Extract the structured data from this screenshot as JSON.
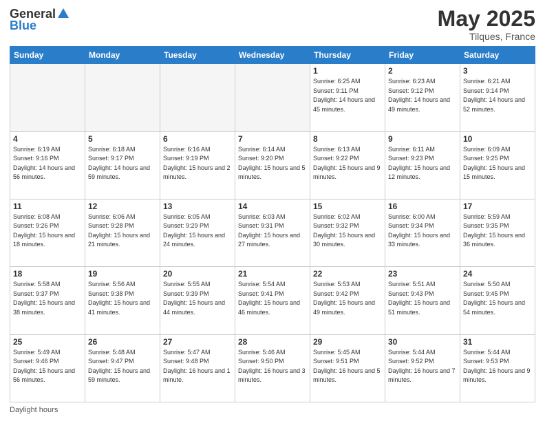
{
  "header": {
    "logo_general": "General",
    "logo_blue": "Blue",
    "title": "May 2025",
    "location": "Tilques, France"
  },
  "days_of_week": [
    "Sunday",
    "Monday",
    "Tuesday",
    "Wednesday",
    "Thursday",
    "Friday",
    "Saturday"
  ],
  "weeks": [
    [
      {
        "day": "",
        "info": ""
      },
      {
        "day": "",
        "info": ""
      },
      {
        "day": "",
        "info": ""
      },
      {
        "day": "",
        "info": ""
      },
      {
        "day": "1",
        "info": "Sunrise: 6:25 AM\nSunset: 9:11 PM\nDaylight: 14 hours\nand 45 minutes."
      },
      {
        "day": "2",
        "info": "Sunrise: 6:23 AM\nSunset: 9:12 PM\nDaylight: 14 hours\nand 49 minutes."
      },
      {
        "day": "3",
        "info": "Sunrise: 6:21 AM\nSunset: 9:14 PM\nDaylight: 14 hours\nand 52 minutes."
      }
    ],
    [
      {
        "day": "4",
        "info": "Sunrise: 6:19 AM\nSunset: 9:16 PM\nDaylight: 14 hours\nand 56 minutes."
      },
      {
        "day": "5",
        "info": "Sunrise: 6:18 AM\nSunset: 9:17 PM\nDaylight: 14 hours\nand 59 minutes."
      },
      {
        "day": "6",
        "info": "Sunrise: 6:16 AM\nSunset: 9:19 PM\nDaylight: 15 hours\nand 2 minutes."
      },
      {
        "day": "7",
        "info": "Sunrise: 6:14 AM\nSunset: 9:20 PM\nDaylight: 15 hours\nand 5 minutes."
      },
      {
        "day": "8",
        "info": "Sunrise: 6:13 AM\nSunset: 9:22 PM\nDaylight: 15 hours\nand 9 minutes."
      },
      {
        "day": "9",
        "info": "Sunrise: 6:11 AM\nSunset: 9:23 PM\nDaylight: 15 hours\nand 12 minutes."
      },
      {
        "day": "10",
        "info": "Sunrise: 6:09 AM\nSunset: 9:25 PM\nDaylight: 15 hours\nand 15 minutes."
      }
    ],
    [
      {
        "day": "11",
        "info": "Sunrise: 6:08 AM\nSunset: 9:26 PM\nDaylight: 15 hours\nand 18 minutes."
      },
      {
        "day": "12",
        "info": "Sunrise: 6:06 AM\nSunset: 9:28 PM\nDaylight: 15 hours\nand 21 minutes."
      },
      {
        "day": "13",
        "info": "Sunrise: 6:05 AM\nSunset: 9:29 PM\nDaylight: 15 hours\nand 24 minutes."
      },
      {
        "day": "14",
        "info": "Sunrise: 6:03 AM\nSunset: 9:31 PM\nDaylight: 15 hours\nand 27 minutes."
      },
      {
        "day": "15",
        "info": "Sunrise: 6:02 AM\nSunset: 9:32 PM\nDaylight: 15 hours\nand 30 minutes."
      },
      {
        "day": "16",
        "info": "Sunrise: 6:00 AM\nSunset: 9:34 PM\nDaylight: 15 hours\nand 33 minutes."
      },
      {
        "day": "17",
        "info": "Sunrise: 5:59 AM\nSunset: 9:35 PM\nDaylight: 15 hours\nand 36 minutes."
      }
    ],
    [
      {
        "day": "18",
        "info": "Sunrise: 5:58 AM\nSunset: 9:37 PM\nDaylight: 15 hours\nand 38 minutes."
      },
      {
        "day": "19",
        "info": "Sunrise: 5:56 AM\nSunset: 9:38 PM\nDaylight: 15 hours\nand 41 minutes."
      },
      {
        "day": "20",
        "info": "Sunrise: 5:55 AM\nSunset: 9:39 PM\nDaylight: 15 hours\nand 44 minutes."
      },
      {
        "day": "21",
        "info": "Sunrise: 5:54 AM\nSunset: 9:41 PM\nDaylight: 15 hours\nand 46 minutes."
      },
      {
        "day": "22",
        "info": "Sunrise: 5:53 AM\nSunset: 9:42 PM\nDaylight: 15 hours\nand 49 minutes."
      },
      {
        "day": "23",
        "info": "Sunrise: 5:51 AM\nSunset: 9:43 PM\nDaylight: 15 hours\nand 51 minutes."
      },
      {
        "day": "24",
        "info": "Sunrise: 5:50 AM\nSunset: 9:45 PM\nDaylight: 15 hours\nand 54 minutes."
      }
    ],
    [
      {
        "day": "25",
        "info": "Sunrise: 5:49 AM\nSunset: 9:46 PM\nDaylight: 15 hours\nand 56 minutes."
      },
      {
        "day": "26",
        "info": "Sunrise: 5:48 AM\nSunset: 9:47 PM\nDaylight: 15 hours\nand 59 minutes."
      },
      {
        "day": "27",
        "info": "Sunrise: 5:47 AM\nSunset: 9:48 PM\nDaylight: 16 hours\nand 1 minute."
      },
      {
        "day": "28",
        "info": "Sunrise: 5:46 AM\nSunset: 9:50 PM\nDaylight: 16 hours\nand 3 minutes."
      },
      {
        "day": "29",
        "info": "Sunrise: 5:45 AM\nSunset: 9:51 PM\nDaylight: 16 hours\nand 5 minutes."
      },
      {
        "day": "30",
        "info": "Sunrise: 5:44 AM\nSunset: 9:52 PM\nDaylight: 16 hours\nand 7 minutes."
      },
      {
        "day": "31",
        "info": "Sunrise: 5:44 AM\nSunset: 9:53 PM\nDaylight: 16 hours\nand 9 minutes."
      }
    ]
  ],
  "footer": {
    "daylight_label": "Daylight hours"
  }
}
